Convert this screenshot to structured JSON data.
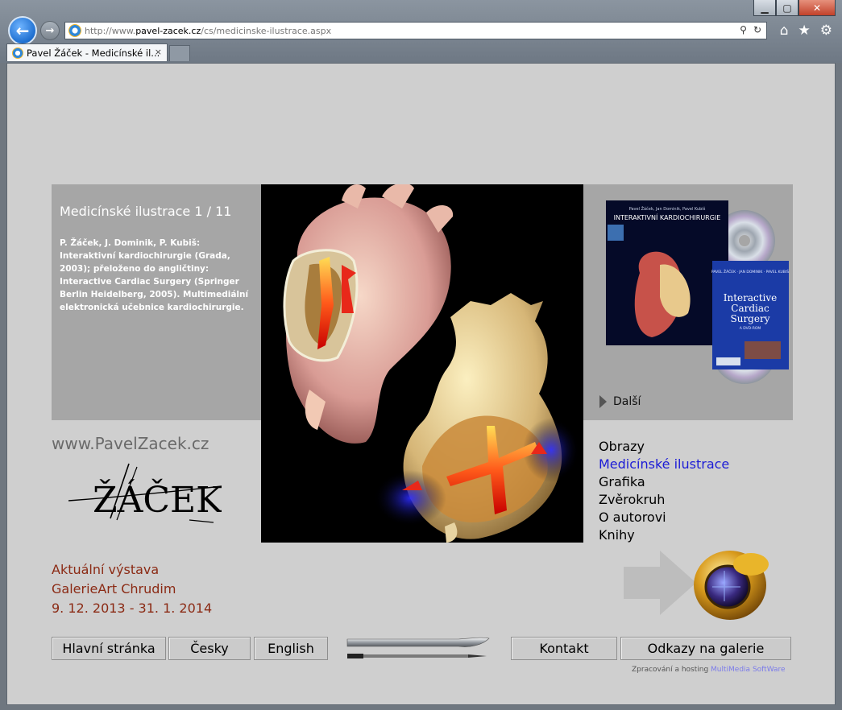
{
  "browser": {
    "url_prefix": "http://www.",
    "url_host": "pavel-zacek.cz",
    "url_path": "/cs/medicinske-ilustrace.aspx",
    "tab_title": "Pavel Žáček - Medicínské il...",
    "tab_close": "×",
    "minimize": "▁",
    "maximize": "▢",
    "close": "✕",
    "back": "←",
    "forward": "→",
    "search_glyph": "⚲",
    "refresh_glyph": "↻",
    "home_glyph": "⌂",
    "favorites_glyph": "★",
    "tools_glyph": "⚙"
  },
  "info": {
    "title": "Medicínské ilustrace 1 / 11",
    "description": "P. Žáček, J. Dominik, P. Kubiš: Interaktivní kardiochirurgie (Grada, 2003); přeloženo do angličtiny: Interactive Cardiac Surgery (Springer Berlin Heidelberg, 2005). Multimediální elektronická učebnice kardiochirurgie."
  },
  "books": {
    "cz_authors": "Pavel Žáček, Jan Dominik, Pavel Kubiš",
    "cz_title": "INTERAKTIVNÍ KARDIOCHIRURGIE",
    "en_authors": "PAVEL ŽÁČEK · JAN DOMINIK · PAVEL KUBIŠ",
    "en_title_1": "Interactive",
    "en_title_2": "Cardiac",
    "en_title_3": "Surgery",
    "en_subtitle": "A DVD-ROM",
    "next_label": "Další"
  },
  "site_url": "www.PavelZacek.cz",
  "logo_text": "ŽÁČEK",
  "menu": [
    {
      "label": "Obrazy",
      "active": false
    },
    {
      "label": "Medicínské ilustrace",
      "active": true
    },
    {
      "label": "Grafika",
      "active": false
    },
    {
      "label": "Zvěrokruh",
      "active": false
    },
    {
      "label": "O autorovi",
      "active": false
    },
    {
      "label": "Knihy",
      "active": false
    }
  ],
  "exhibition": {
    "line1": "Aktuální výstava",
    "line2": "GalerieArt Chrudim",
    "line3": "9. 12. 2013 - 31. 1. 2014"
  },
  "buttons": {
    "home": "Hlavní stránka",
    "czech": "Česky",
    "english": "English",
    "contact": "Kontakt",
    "links": "Odkazy na galerie"
  },
  "credit": {
    "text": "Zpracování a hosting ",
    "company": "MultiMedia SoftWare"
  },
  "colors": {
    "panel_gray": "#a6a6a6",
    "page_bg": "#cfcfcf",
    "menu_active": "#1c1cd6",
    "exhibition": "#8b2a14"
  }
}
